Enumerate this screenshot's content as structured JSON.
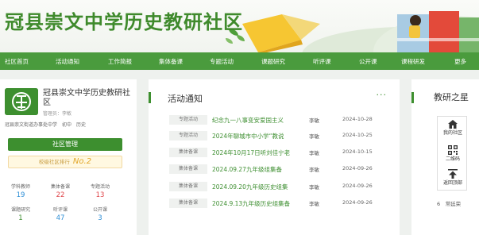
{
  "site": {
    "title": "冠县崇文中学历史教研社区"
  },
  "nav": {
    "items": [
      "社区首页",
      "活动通知",
      "工作简报",
      "集体备课",
      "专题活动",
      "课题研究",
      "听评课",
      "公开课",
      "课程研发",
      "更多"
    ]
  },
  "profile": {
    "name": "冠县崇文中学历史教研社区",
    "admin": "管理员：李敏",
    "school": "冠县崇文街道办事处中学　初中　历史",
    "manage_button": "社区管理",
    "rank_label": "校级社区排行",
    "rank_value": "No.2",
    "stats": [
      {
        "label": "学科教师",
        "value": "19",
        "color": "#2e8fd6"
      },
      {
        "label": "集体备课",
        "value": "22",
        "color": "#e0464b"
      },
      {
        "label": "专题活动",
        "value": "13",
        "color": "#e0464b"
      },
      {
        "label": "课题研究",
        "value": "1",
        "color": "#3e8f31"
      },
      {
        "label": "听评课",
        "value": "47",
        "color": "#2e8fd6"
      },
      {
        "label": "公开课",
        "value": "3",
        "color": "#2e8fd6"
      }
    ]
  },
  "notices": {
    "title": "活动通知",
    "more": "···",
    "rows": [
      {
        "tag": "专题活动",
        "title": "纪念九一八事变安爱国主义",
        "author": "李敏",
        "date": "2024-10-28"
      },
      {
        "tag": "专题活动",
        "title": "2024年聊城市中小学“教说",
        "author": "李敏",
        "date": "2024-10-25"
      },
      {
        "tag": "集体备课",
        "title": "2024年10月17日听刘佳宁老",
        "author": "李敏",
        "date": "2024-10-15"
      },
      {
        "tag": "集体备课",
        "title": "2024.09.27九年级组集备",
        "author": "李敏",
        "date": "2024-09-26"
      },
      {
        "tag": "集体备课",
        "title": "2024.09.20九年级历史组集",
        "author": "李敏",
        "date": "2024-09-26"
      },
      {
        "tag": "集体备课",
        "title": "2024.9.13九年级历史组集备",
        "author": "李敏",
        "date": "2024-09-26"
      }
    ]
  },
  "teaching_stars": {
    "title": "教研之星",
    "visible_item": "6　常廷荣"
  },
  "float_menu": {
    "items": [
      {
        "label": "我的社区",
        "icon": "home-icon"
      },
      {
        "label": "二维码",
        "icon": "qrcode-icon"
      },
      {
        "label": "返回顶部",
        "icon": "arrow-up-icon"
      }
    ]
  },
  "colors": {
    "brand": "#4a9b3d",
    "accent_link": "#3e8f31",
    "rank": "#e2a628"
  }
}
